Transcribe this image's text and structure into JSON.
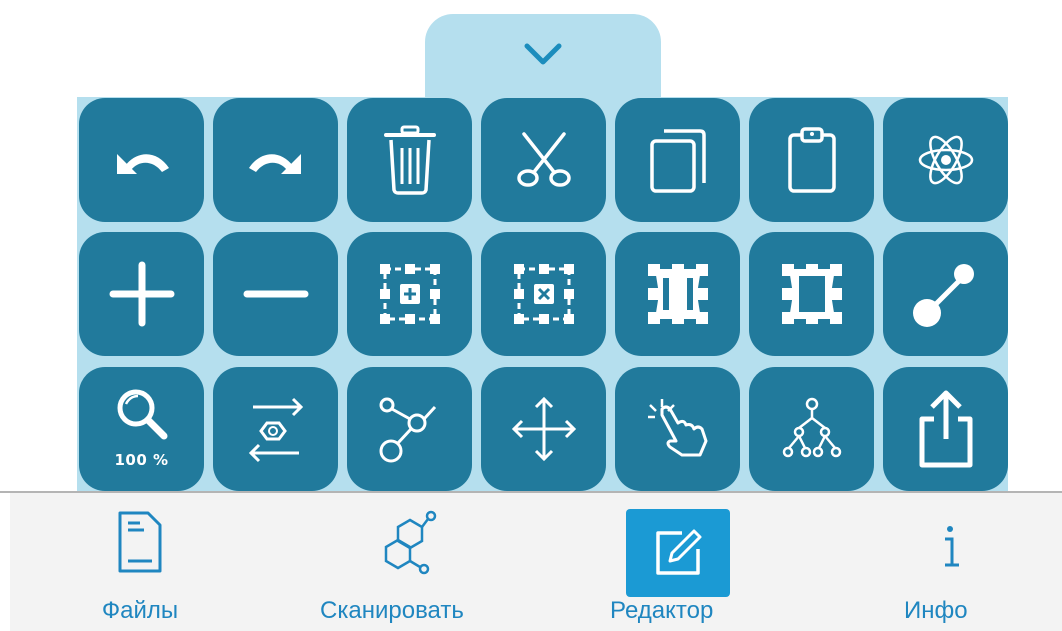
{
  "toolbar": {
    "collapse_icon": "chevron-down-icon",
    "accent_color": "#217a9c",
    "panel_color": "#b5dfee",
    "rows": [
      [
        {
          "name": "undo",
          "icon": "undo-icon"
        },
        {
          "name": "redo",
          "icon": "redo-icon"
        },
        {
          "name": "delete",
          "icon": "trash-icon"
        },
        {
          "name": "cut",
          "icon": "scissors-icon"
        },
        {
          "name": "copy",
          "icon": "copy-icon"
        },
        {
          "name": "paste",
          "icon": "clipboard-icon"
        },
        {
          "name": "atom",
          "icon": "atom-icon"
        }
      ],
      [
        {
          "name": "zoom-in",
          "icon": "plus-icon"
        },
        {
          "name": "zoom-out",
          "icon": "minus-icon"
        },
        {
          "name": "add-selection",
          "icon": "select-plus-icon"
        },
        {
          "name": "remove-selection",
          "icon": "select-x-icon"
        },
        {
          "name": "select-bold",
          "icon": "select-bold-icon"
        },
        {
          "name": "select-thin",
          "icon": "select-thin-icon"
        },
        {
          "name": "bond",
          "icon": "bond-icon"
        }
      ],
      [
        {
          "name": "zoom-reset",
          "icon": "zoom-100-icon",
          "label": "100 %"
        },
        {
          "name": "reaction",
          "icon": "reaction-icon"
        },
        {
          "name": "chain",
          "icon": "chain-icon"
        },
        {
          "name": "move",
          "icon": "move-icon"
        },
        {
          "name": "tap",
          "icon": "tap-icon"
        },
        {
          "name": "tree",
          "icon": "tree-icon"
        },
        {
          "name": "share",
          "icon": "share-icon"
        }
      ]
    ]
  },
  "nav": {
    "active_color": "#1b9ad4",
    "label_color": "#1f86c0",
    "items": [
      {
        "label": "Файлы",
        "icon": "file-icon"
      },
      {
        "label": "Сканировать",
        "icon": "molecule-icon"
      },
      {
        "label": "Редактор",
        "icon": "edit-icon",
        "active": true
      },
      {
        "label": "Инфо",
        "icon": "info-icon"
      }
    ]
  }
}
